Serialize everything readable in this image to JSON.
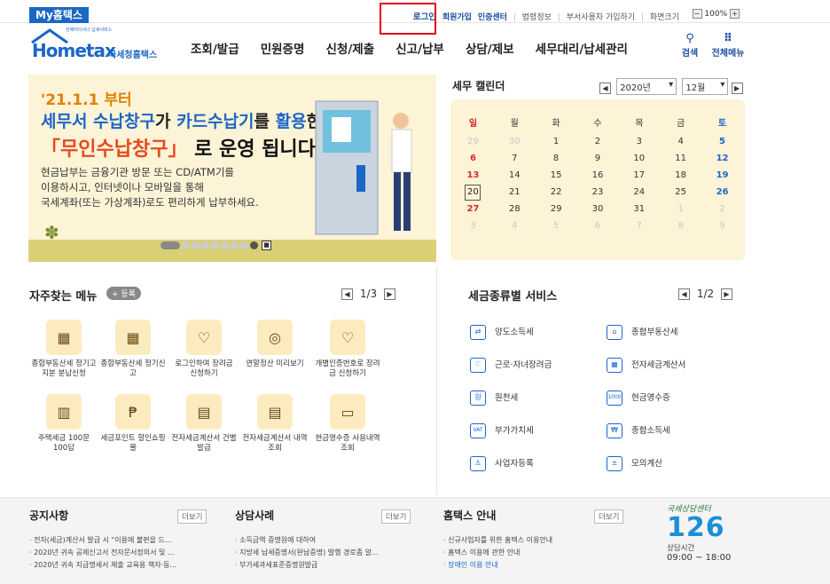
{
  "header": {
    "mytax": "My홈택스",
    "util": {
      "login": "로그인",
      "join": "회원가입",
      "cert": "인증센터",
      "law": "법령정보",
      "dept": "부서사용자 가입하기",
      "zoom_label": "화면크기",
      "zoom_value": "100%"
    },
    "logo": {
      "main": "Hometax",
      "sub": "국세청홈택스",
      "tag": "언제어디서나 납세서비스"
    },
    "gnb": [
      "조회/발급",
      "민원증명",
      "신청/제출",
      "신고/납부",
      "상담/제보",
      "세무대리/납세관리"
    ],
    "search_label": "검색",
    "allmenu_label": "전체메뉴"
  },
  "hero": {
    "date": "'21.1.1 부터",
    "line2_a": "세무서 수납창구",
    "line2_b": "가 ",
    "line2_c": "카드수납기",
    "line2_d": "를 ",
    "line2_e": "활용",
    "line2_f": "한",
    "line3_a": "「무인수납창구」",
    "line3_b": " 로 운영 됩니다.",
    "desc": [
      "현금납부는 금융기관 방문 또는 CD/ATM기를",
      "이용하시고, 인터넷이나 모바일을 통해",
      "국세계좌(또는 가상계좌)로도 편리하게 납부하세요."
    ]
  },
  "calendar": {
    "title": "세무 캘린더",
    "year": "2020년",
    "month": "12월",
    "weekdays": [
      "일",
      "월",
      "화",
      "수",
      "목",
      "금",
      "토"
    ],
    "weeks": [
      [
        {
          "d": "29",
          "t": "dim"
        },
        {
          "d": "30",
          "t": "dim"
        },
        {
          "d": "1",
          "t": ""
        },
        {
          "d": "2",
          "t": ""
        },
        {
          "d": "3",
          "t": ""
        },
        {
          "d": "4",
          "t": ""
        },
        {
          "d": "5",
          "t": "sat"
        }
      ],
      [
        {
          "d": "6",
          "t": "sun"
        },
        {
          "d": "7",
          "t": ""
        },
        {
          "d": "8",
          "t": ""
        },
        {
          "d": "9",
          "t": ""
        },
        {
          "d": "10",
          "t": ""
        },
        {
          "d": "11",
          "t": ""
        },
        {
          "d": "12",
          "t": "sat"
        }
      ],
      [
        {
          "d": "13",
          "t": "sun"
        },
        {
          "d": "14",
          "t": ""
        },
        {
          "d": "15",
          "t": ""
        },
        {
          "d": "16",
          "t": ""
        },
        {
          "d": "17",
          "t": ""
        },
        {
          "d": "18",
          "t": ""
        },
        {
          "d": "19",
          "t": "sat"
        }
      ],
      [
        {
          "d": "20",
          "t": "today"
        },
        {
          "d": "21",
          "t": ""
        },
        {
          "d": "22",
          "t": ""
        },
        {
          "d": "23",
          "t": ""
        },
        {
          "d": "24",
          "t": ""
        },
        {
          "d": "25",
          "t": ""
        },
        {
          "d": "26",
          "t": "sat"
        }
      ],
      [
        {
          "d": "27",
          "t": "sun"
        },
        {
          "d": "28",
          "t": ""
        },
        {
          "d": "29",
          "t": ""
        },
        {
          "d": "30",
          "t": ""
        },
        {
          "d": "31",
          "t": ""
        },
        {
          "d": "1",
          "t": "dim"
        },
        {
          "d": "2",
          "t": "dim"
        }
      ],
      [
        {
          "d": "3",
          "t": "dim"
        },
        {
          "d": "4",
          "t": "dim"
        },
        {
          "d": "5",
          "t": "dim"
        },
        {
          "d": "6",
          "t": "dim"
        },
        {
          "d": "7",
          "t": "dim"
        },
        {
          "d": "8",
          "t": "dim"
        },
        {
          "d": "9",
          "t": "dim"
        }
      ]
    ]
  },
  "favorites": {
    "title": "자주찾는 메뉴",
    "register": "+ 등록",
    "page": "1/3",
    "items": [
      {
        "icon": "calendar-icon",
        "glyph": "▦",
        "label": "종합부동산세 정기고지분 분납신청"
      },
      {
        "icon": "calendar-edit-icon",
        "glyph": "▦",
        "label": "종합부동산세 정기신고"
      },
      {
        "icon": "heart-pen-icon",
        "glyph": "♡",
        "label": "로그인하여 장려금 신청하기"
      },
      {
        "icon": "coins-icon",
        "glyph": "◎",
        "label": "연말정산 미리보기"
      },
      {
        "icon": "heart-id-icon",
        "glyph": "♡",
        "label": "개별인증번호로 장려금 신청하기"
      },
      {
        "icon": "building-icon",
        "glyph": "▥",
        "label": "주택세금 100문100답"
      },
      {
        "icon": "bag-icon",
        "glyph": "₱",
        "label": "세금포인트 할인쇼핑몰"
      },
      {
        "icon": "invoice-icon",
        "glyph": "▤",
        "label": "전자세금계산서 건별발급"
      },
      {
        "icon": "invoice-search-icon",
        "glyph": "▤",
        "label": "전자세금계산서 내역조회"
      },
      {
        "icon": "cash-receipt-icon",
        "glyph": "▭",
        "label": "현금영수증 사용내역조회"
      }
    ]
  },
  "services": {
    "title": "세금종류별 서비스",
    "page": "1/2",
    "items": [
      {
        "icon": "transfer-icon",
        "glyph": "⇄",
        "label": "양도소득세"
      },
      {
        "icon": "property-icon",
        "glyph": "⌂",
        "label": "종합부동산세"
      },
      {
        "icon": "heart-icon",
        "glyph": "♡",
        "label": "근로·자녀장려금"
      },
      {
        "icon": "calculator-icon",
        "glyph": "▦",
        "label": "전자세금계산서"
      },
      {
        "icon": "withholding-icon",
        "glyph": "원",
        "label": "원천세"
      },
      {
        "icon": "receipt-icon",
        "glyph": "1000",
        "label": "현금영수증"
      },
      {
        "icon": "vat-icon",
        "glyph": "VAT",
        "label": "부가가치세"
      },
      {
        "icon": "income-icon",
        "glyph": "₩",
        "label": "종합소득세"
      },
      {
        "icon": "person-icon",
        "glyph": "♙",
        "label": "사업자등록"
      },
      {
        "icon": "mock-calc-icon",
        "glyph": "±",
        "label": "모의계산"
      }
    ]
  },
  "bottom": {
    "notice": {
      "title": "공지사항",
      "more": "더보기",
      "items": [
        "· 전자(세금)계산서 발급 시 \"이용에 불편을 드...",
        "· 2020년 귀속 공제신고서 전자문서정의서 및 ...",
        "· 2020년 귀속 지급명세서 제출 교육용 책자·동..."
      ]
    },
    "consult": {
      "title": "상담사례",
      "more": "더보기",
      "items": [
        "· 소득금액 증명원에 대하여",
        "· 지방세 납세증명서(완납증명) 발행 경로좀 알...",
        "· 부가세과세표준증명원발급"
      ]
    },
    "guide": {
      "title": "홈택스 안내",
      "more": "더보기",
      "items": [
        "· 신규사업자를 위한 홈택스 이용안내",
        "· 홈택스 이용에 관한 안내",
        "· 장애인 이용 안내"
      ]
    },
    "center": {
      "caption": "국세상담센터",
      "number": "126",
      "hours_label": "상담시간",
      "hours": "09:00 ~ 18:00"
    }
  }
}
